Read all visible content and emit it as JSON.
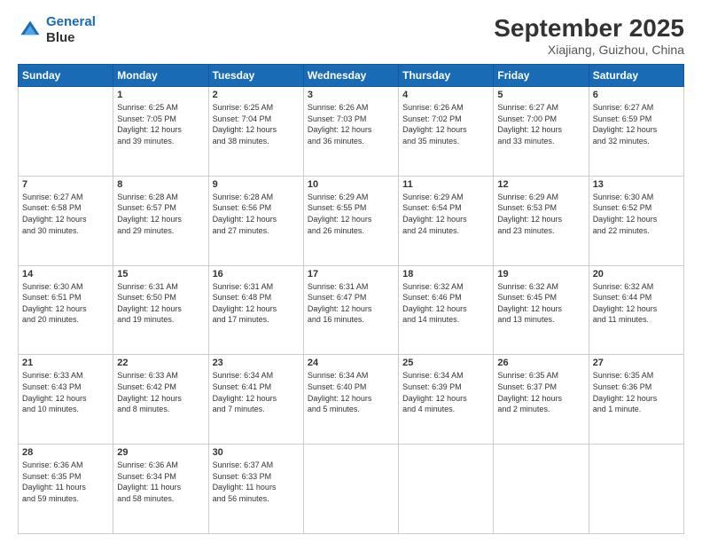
{
  "header": {
    "logo_line1": "General",
    "logo_line2": "Blue",
    "month": "September 2025",
    "location": "Xiajiang, Guizhou, China"
  },
  "days_of_week": [
    "Sunday",
    "Monday",
    "Tuesday",
    "Wednesday",
    "Thursday",
    "Friday",
    "Saturday"
  ],
  "weeks": [
    [
      {
        "num": "",
        "info": ""
      },
      {
        "num": "1",
        "info": "Sunrise: 6:25 AM\nSunset: 7:05 PM\nDaylight: 12 hours\nand 39 minutes."
      },
      {
        "num": "2",
        "info": "Sunrise: 6:25 AM\nSunset: 7:04 PM\nDaylight: 12 hours\nand 38 minutes."
      },
      {
        "num": "3",
        "info": "Sunrise: 6:26 AM\nSunset: 7:03 PM\nDaylight: 12 hours\nand 36 minutes."
      },
      {
        "num": "4",
        "info": "Sunrise: 6:26 AM\nSunset: 7:02 PM\nDaylight: 12 hours\nand 35 minutes."
      },
      {
        "num": "5",
        "info": "Sunrise: 6:27 AM\nSunset: 7:00 PM\nDaylight: 12 hours\nand 33 minutes."
      },
      {
        "num": "6",
        "info": "Sunrise: 6:27 AM\nSunset: 6:59 PM\nDaylight: 12 hours\nand 32 minutes."
      }
    ],
    [
      {
        "num": "7",
        "info": "Sunrise: 6:27 AM\nSunset: 6:58 PM\nDaylight: 12 hours\nand 30 minutes."
      },
      {
        "num": "8",
        "info": "Sunrise: 6:28 AM\nSunset: 6:57 PM\nDaylight: 12 hours\nand 29 minutes."
      },
      {
        "num": "9",
        "info": "Sunrise: 6:28 AM\nSunset: 6:56 PM\nDaylight: 12 hours\nand 27 minutes."
      },
      {
        "num": "10",
        "info": "Sunrise: 6:29 AM\nSunset: 6:55 PM\nDaylight: 12 hours\nand 26 minutes."
      },
      {
        "num": "11",
        "info": "Sunrise: 6:29 AM\nSunset: 6:54 PM\nDaylight: 12 hours\nand 24 minutes."
      },
      {
        "num": "12",
        "info": "Sunrise: 6:29 AM\nSunset: 6:53 PM\nDaylight: 12 hours\nand 23 minutes."
      },
      {
        "num": "13",
        "info": "Sunrise: 6:30 AM\nSunset: 6:52 PM\nDaylight: 12 hours\nand 22 minutes."
      }
    ],
    [
      {
        "num": "14",
        "info": "Sunrise: 6:30 AM\nSunset: 6:51 PM\nDaylight: 12 hours\nand 20 minutes."
      },
      {
        "num": "15",
        "info": "Sunrise: 6:31 AM\nSunset: 6:50 PM\nDaylight: 12 hours\nand 19 minutes."
      },
      {
        "num": "16",
        "info": "Sunrise: 6:31 AM\nSunset: 6:48 PM\nDaylight: 12 hours\nand 17 minutes."
      },
      {
        "num": "17",
        "info": "Sunrise: 6:31 AM\nSunset: 6:47 PM\nDaylight: 12 hours\nand 16 minutes."
      },
      {
        "num": "18",
        "info": "Sunrise: 6:32 AM\nSunset: 6:46 PM\nDaylight: 12 hours\nand 14 minutes."
      },
      {
        "num": "19",
        "info": "Sunrise: 6:32 AM\nSunset: 6:45 PM\nDaylight: 12 hours\nand 13 minutes."
      },
      {
        "num": "20",
        "info": "Sunrise: 6:32 AM\nSunset: 6:44 PM\nDaylight: 12 hours\nand 11 minutes."
      }
    ],
    [
      {
        "num": "21",
        "info": "Sunrise: 6:33 AM\nSunset: 6:43 PM\nDaylight: 12 hours\nand 10 minutes."
      },
      {
        "num": "22",
        "info": "Sunrise: 6:33 AM\nSunset: 6:42 PM\nDaylight: 12 hours\nand 8 minutes."
      },
      {
        "num": "23",
        "info": "Sunrise: 6:34 AM\nSunset: 6:41 PM\nDaylight: 12 hours\nand 7 minutes."
      },
      {
        "num": "24",
        "info": "Sunrise: 6:34 AM\nSunset: 6:40 PM\nDaylight: 12 hours\nand 5 minutes."
      },
      {
        "num": "25",
        "info": "Sunrise: 6:34 AM\nSunset: 6:39 PM\nDaylight: 12 hours\nand 4 minutes."
      },
      {
        "num": "26",
        "info": "Sunrise: 6:35 AM\nSunset: 6:37 PM\nDaylight: 12 hours\nand 2 minutes."
      },
      {
        "num": "27",
        "info": "Sunrise: 6:35 AM\nSunset: 6:36 PM\nDaylight: 12 hours\nand 1 minute."
      }
    ],
    [
      {
        "num": "28",
        "info": "Sunrise: 6:36 AM\nSunset: 6:35 PM\nDaylight: 11 hours\nand 59 minutes."
      },
      {
        "num": "29",
        "info": "Sunrise: 6:36 AM\nSunset: 6:34 PM\nDaylight: 11 hours\nand 58 minutes."
      },
      {
        "num": "30",
        "info": "Sunrise: 6:37 AM\nSunset: 6:33 PM\nDaylight: 11 hours\nand 56 minutes."
      },
      {
        "num": "",
        "info": ""
      },
      {
        "num": "",
        "info": ""
      },
      {
        "num": "",
        "info": ""
      },
      {
        "num": "",
        "info": ""
      }
    ]
  ]
}
